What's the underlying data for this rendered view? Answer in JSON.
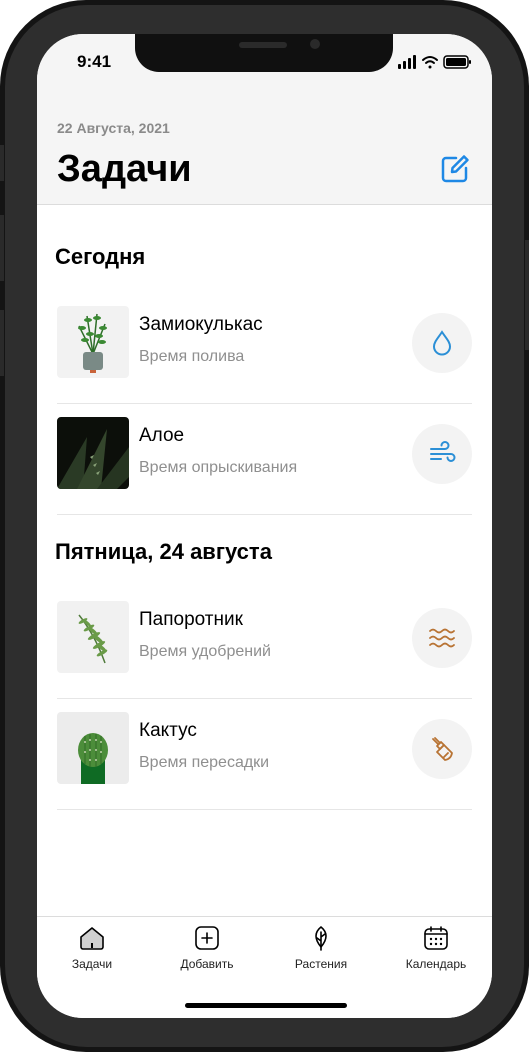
{
  "status": {
    "time": "9:41"
  },
  "header": {
    "date": "22 Августа, 2021",
    "title": "Задачи"
  },
  "sections": [
    {
      "title": "Сегодня",
      "items": [
        {
          "name": "Замиокулькас",
          "task": "Время полива",
          "icon": "water-drop-icon"
        },
        {
          "name": "Алое",
          "task": "Время опрыскивания",
          "icon": "wind-icon"
        }
      ]
    },
    {
      "title": "Пятница, 24 августа",
      "items": [
        {
          "name": "Папоротник",
          "task": "Время удобрений",
          "icon": "waves-icon"
        },
        {
          "name": "Кактус",
          "task": "Время пересадки",
          "icon": "brush-icon"
        }
      ]
    }
  ],
  "tabbar": {
    "tabs": [
      {
        "label": "Задачи",
        "icon": "home-icon"
      },
      {
        "label": "Добавить",
        "icon": "plus-square-icon"
      },
      {
        "label": "Растения",
        "icon": "leaf-icon"
      },
      {
        "label": "Календарь",
        "icon": "calendar-icon"
      }
    ]
  },
  "colors": {
    "accent": "#1e88e5",
    "earth": "#b87333",
    "water": "#2b8fd6"
  }
}
